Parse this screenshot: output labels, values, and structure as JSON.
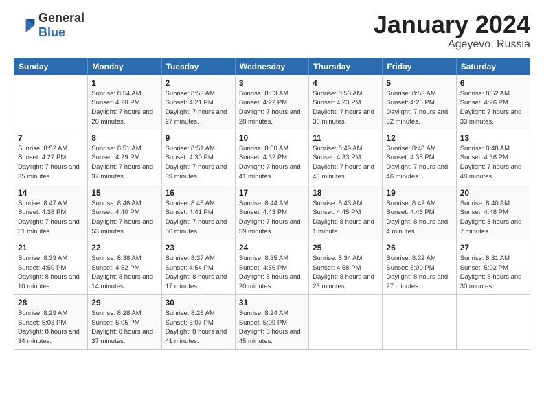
{
  "logo": {
    "general": "General",
    "blue": "Blue"
  },
  "header": {
    "month": "January 2024",
    "location": "Ageyevo, Russia"
  },
  "days_header": [
    "Sunday",
    "Monday",
    "Tuesday",
    "Wednesday",
    "Thursday",
    "Friday",
    "Saturday"
  ],
  "weeks": [
    [
      {
        "day": "",
        "sunrise": "",
        "sunset": "",
        "daylight": ""
      },
      {
        "day": "1",
        "sunrise": "Sunrise: 8:54 AM",
        "sunset": "Sunset: 4:20 PM",
        "daylight": "Daylight: 7 hours and 26 minutes."
      },
      {
        "day": "2",
        "sunrise": "Sunrise: 8:53 AM",
        "sunset": "Sunset: 4:21 PM",
        "daylight": "Daylight: 7 hours and 27 minutes."
      },
      {
        "day": "3",
        "sunrise": "Sunrise: 8:53 AM",
        "sunset": "Sunset: 4:22 PM",
        "daylight": "Daylight: 7 hours and 28 minutes."
      },
      {
        "day": "4",
        "sunrise": "Sunrise: 8:53 AM",
        "sunset": "Sunset: 4:23 PM",
        "daylight": "Daylight: 7 hours and 30 minutes."
      },
      {
        "day": "5",
        "sunrise": "Sunrise: 8:53 AM",
        "sunset": "Sunset: 4:25 PM",
        "daylight": "Daylight: 7 hours and 32 minutes."
      },
      {
        "day": "6",
        "sunrise": "Sunrise: 8:52 AM",
        "sunset": "Sunset: 4:26 PM",
        "daylight": "Daylight: 7 hours and 33 minutes."
      }
    ],
    [
      {
        "day": "7",
        "sunrise": "Sunrise: 8:52 AM",
        "sunset": "Sunset: 4:27 PM",
        "daylight": "Daylight: 7 hours and 35 minutes."
      },
      {
        "day": "8",
        "sunrise": "Sunrise: 8:51 AM",
        "sunset": "Sunset: 4:29 PM",
        "daylight": "Daylight: 7 hours and 37 minutes."
      },
      {
        "day": "9",
        "sunrise": "Sunrise: 8:51 AM",
        "sunset": "Sunset: 4:30 PM",
        "daylight": "Daylight: 7 hours and 39 minutes."
      },
      {
        "day": "10",
        "sunrise": "Sunrise: 8:50 AM",
        "sunset": "Sunset: 4:32 PM",
        "daylight": "Daylight: 7 hours and 41 minutes."
      },
      {
        "day": "11",
        "sunrise": "Sunrise: 8:49 AM",
        "sunset": "Sunset: 4:33 PM",
        "daylight": "Daylight: 7 hours and 43 minutes."
      },
      {
        "day": "12",
        "sunrise": "Sunrise: 8:48 AM",
        "sunset": "Sunset: 4:35 PM",
        "daylight": "Daylight: 7 hours and 46 minutes."
      },
      {
        "day": "13",
        "sunrise": "Sunrise: 8:48 AM",
        "sunset": "Sunset: 4:36 PM",
        "daylight": "Daylight: 7 hours and 48 minutes."
      }
    ],
    [
      {
        "day": "14",
        "sunrise": "Sunrise: 8:47 AM",
        "sunset": "Sunset: 4:38 PM",
        "daylight": "Daylight: 7 hours and 51 minutes."
      },
      {
        "day": "15",
        "sunrise": "Sunrise: 8:46 AM",
        "sunset": "Sunset: 4:40 PM",
        "daylight": "Daylight: 7 hours and 53 minutes."
      },
      {
        "day": "16",
        "sunrise": "Sunrise: 8:45 AM",
        "sunset": "Sunset: 4:41 PM",
        "daylight": "Daylight: 7 hours and 56 minutes."
      },
      {
        "day": "17",
        "sunrise": "Sunrise: 8:44 AM",
        "sunset": "Sunset: 4:43 PM",
        "daylight": "Daylight: 7 hours and 59 minutes."
      },
      {
        "day": "18",
        "sunrise": "Sunrise: 8:43 AM",
        "sunset": "Sunset: 4:45 PM",
        "daylight": "Daylight: 8 hours and 1 minute."
      },
      {
        "day": "19",
        "sunrise": "Sunrise: 8:42 AM",
        "sunset": "Sunset: 4:46 PM",
        "daylight": "Daylight: 8 hours and 4 minutes."
      },
      {
        "day": "20",
        "sunrise": "Sunrise: 8:40 AM",
        "sunset": "Sunset: 4:48 PM",
        "daylight": "Daylight: 8 hours and 7 minutes."
      }
    ],
    [
      {
        "day": "21",
        "sunrise": "Sunrise: 8:39 AM",
        "sunset": "Sunset: 4:50 PM",
        "daylight": "Daylight: 8 hours and 10 minutes."
      },
      {
        "day": "22",
        "sunrise": "Sunrise: 8:38 AM",
        "sunset": "Sunset: 4:52 PM",
        "daylight": "Daylight: 8 hours and 14 minutes."
      },
      {
        "day": "23",
        "sunrise": "Sunrise: 8:37 AM",
        "sunset": "Sunset: 4:54 PM",
        "daylight": "Daylight: 8 hours and 17 minutes."
      },
      {
        "day": "24",
        "sunrise": "Sunrise: 8:35 AM",
        "sunset": "Sunset: 4:56 PM",
        "daylight": "Daylight: 8 hours and 20 minutes."
      },
      {
        "day": "25",
        "sunrise": "Sunrise: 8:34 AM",
        "sunset": "Sunset: 4:58 PM",
        "daylight": "Daylight: 8 hours and 23 minutes."
      },
      {
        "day": "26",
        "sunrise": "Sunrise: 8:32 AM",
        "sunset": "Sunset: 5:00 PM",
        "daylight": "Daylight: 8 hours and 27 minutes."
      },
      {
        "day": "27",
        "sunrise": "Sunrise: 8:31 AM",
        "sunset": "Sunset: 5:02 PM",
        "daylight": "Daylight: 8 hours and 30 minutes."
      }
    ],
    [
      {
        "day": "28",
        "sunrise": "Sunrise: 8:29 AM",
        "sunset": "Sunset: 5:03 PM",
        "daylight": "Daylight: 8 hours and 34 minutes."
      },
      {
        "day": "29",
        "sunrise": "Sunrise: 8:28 AM",
        "sunset": "Sunset: 5:05 PM",
        "daylight": "Daylight: 8 hours and 37 minutes."
      },
      {
        "day": "30",
        "sunrise": "Sunrise: 8:26 AM",
        "sunset": "Sunset: 5:07 PM",
        "daylight": "Daylight: 8 hours and 41 minutes."
      },
      {
        "day": "31",
        "sunrise": "Sunrise: 8:24 AM",
        "sunset": "Sunset: 5:09 PM",
        "daylight": "Daylight: 8 hours and 45 minutes."
      },
      {
        "day": "",
        "sunrise": "",
        "sunset": "",
        "daylight": ""
      },
      {
        "day": "",
        "sunrise": "",
        "sunset": "",
        "daylight": ""
      },
      {
        "day": "",
        "sunrise": "",
        "sunset": "",
        "daylight": ""
      }
    ]
  ]
}
